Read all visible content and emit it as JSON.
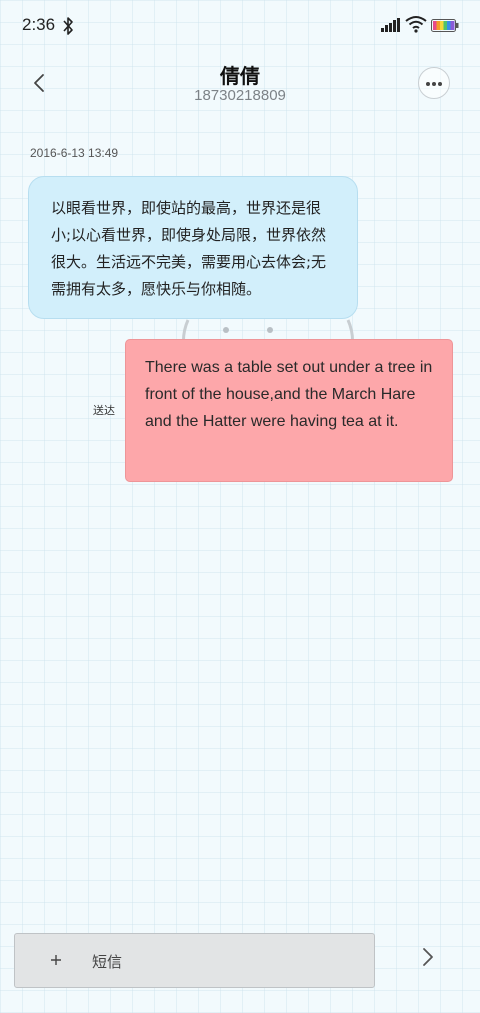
{
  "status_bar": {
    "time": "2:36",
    "icons": [
      "bluetooth-icon",
      "signal-icon",
      "wifi-icon",
      "battery-icon"
    ]
  },
  "header": {
    "contact_name": "倩倩",
    "contact_number": "18730218809",
    "back_icon": "chevron-left-icon",
    "more_icon": "more-dots-icon"
  },
  "conversation": {
    "timestamp": "2016-6-13 13:49",
    "received": {
      "text": "以眼看世界，即使站的最高，世界还是很小;以心看世界，即使身处局限，世界依然很大。生活远不完美，需要用心去体会;无需拥有太多，愿快乐与你相随。"
    },
    "sent": {
      "text": "There was a table set out under a tree in front of the house,and the March Hare and the Hatter were having tea at it.",
      "status": "送达"
    }
  },
  "composer": {
    "placeholder": "短信",
    "add_icon": "plus-icon",
    "send_icon": "chevron-right-icon"
  },
  "colors": {
    "received_bubble": "#d2effb",
    "sent_bubble": "#fda7aa",
    "background": "#f2fafd"
  }
}
